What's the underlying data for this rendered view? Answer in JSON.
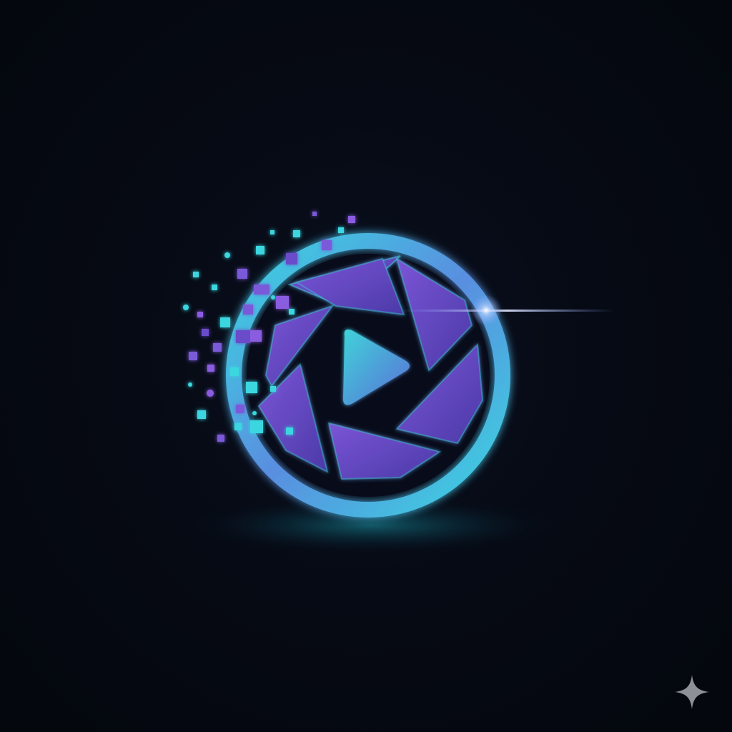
{
  "logo": {
    "name": "aperture-play-logo",
    "accent_cyan": "#3ad6e0",
    "accent_purple": "#6a4bc9",
    "accent_violet": "#8a5be0",
    "background": "#05080f"
  },
  "watermark": {
    "icon": "sparkle-icon",
    "color": "#8e9097"
  }
}
